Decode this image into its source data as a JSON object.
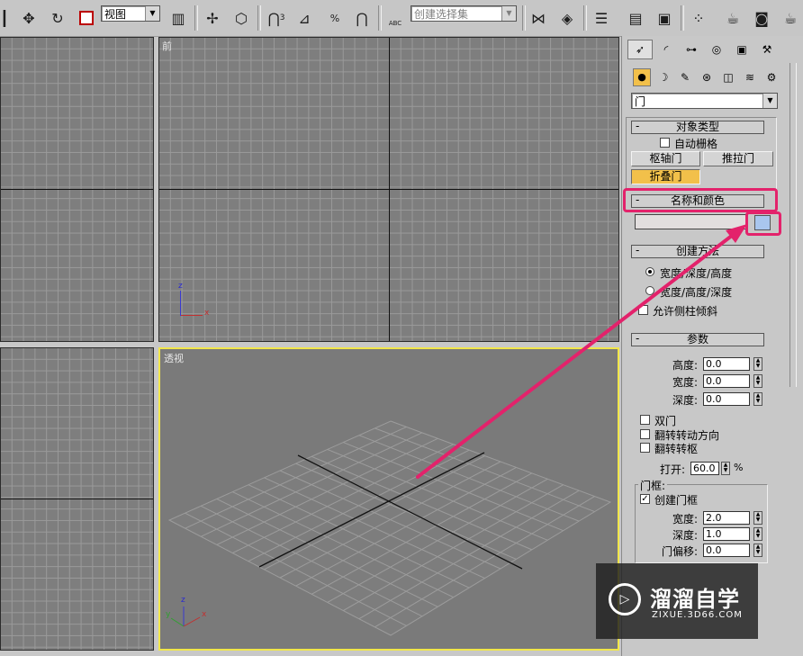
{
  "toolbar": {
    "view_dropdown": "视图",
    "selection_set_placeholder": "创建选择集",
    "snap3_label": "3",
    "percent_label": "%",
    "abc_label": "ABC"
  },
  "viewports": {
    "front_label": "前",
    "perspective_label": "透视",
    "axis_x": "x",
    "axis_y": "y",
    "axis_z": "z"
  },
  "panel": {
    "category_dropdown": "门",
    "object_type": {
      "title": "对象类型",
      "autogrid": "自动栅格",
      "pivot_door": "枢轴门",
      "sliding_door": "推拉门",
      "bifold_door": "折叠门"
    },
    "name_color": {
      "title": "名称和颜色",
      "name_value": "",
      "color_swatch": "#a9c6ee"
    },
    "creation_method": {
      "title": "创建方法",
      "option1": "宽度/深度/高度",
      "option2": "宽度/高度/深度",
      "allow_non_vertical": "允许侧柱倾斜"
    },
    "parameters": {
      "title": "参数",
      "height_label": "高度:",
      "height_value": "0.0",
      "width_label": "宽度:",
      "width_value": "0.0",
      "depth_label": "深度:",
      "depth_value": "0.0",
      "double_doors": "双门",
      "flip_swing": "翻转转动方向",
      "flip_hinge": "翻转转枢",
      "open_label": "打开:",
      "open_value": "60.0",
      "open_unit": "%",
      "frame_group": "门框:",
      "create_frame": "创建门框",
      "frame_width_label": "宽度:",
      "frame_width_value": "2.0",
      "frame_depth_label": "深度:",
      "frame_depth_value": "1.0",
      "door_offset_label": "门偏移:",
      "door_offset_value": "0.0"
    }
  },
  "watermark": {
    "name": "溜溜自学",
    "url": "ZIXUE.3D66.COM"
  },
  "colors": {
    "highlight": "#e3226b",
    "bifold_active": "#f2c04a",
    "active_viewport_border": "#f1e64a"
  }
}
